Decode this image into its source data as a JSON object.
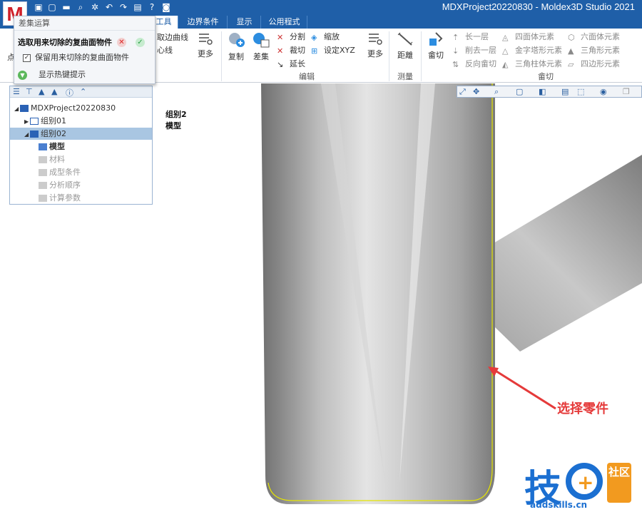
{
  "app": {
    "title": "MDXProject20220830 - Moldex3D Studio 2021",
    "logo": "M"
  },
  "quick_access": [
    "save-icon",
    "new-icon",
    "open-icon",
    "find-icon",
    "gear-icon",
    "undo-icon",
    "redo-icon",
    "report-icon",
    "help-icon",
    "camera-icon"
  ],
  "tabs": [
    {
      "label": "工具",
      "active": true
    },
    {
      "label": "边界条件"
    },
    {
      "label": "显示"
    },
    {
      "label": "公用程式"
    }
  ],
  "ribbon": {
    "left_items": [
      "取边曲线",
      "心线"
    ],
    "more1": "更多",
    "copy": "复制",
    "diff": "差集",
    "edit": {
      "split": "分割",
      "cut": "裁切",
      "extend": "延长",
      "scale": "缩放",
      "setxyz": "设定XYZ",
      "more": "更多"
    },
    "measure": {
      "distance": "距離",
      "more": "更多"
    },
    "dice": {
      "label": "畲切",
      "up": "长一层",
      "down": "削去一层",
      "rev": "反向畲切"
    },
    "elements": {
      "tetra": "四面体元素",
      "pyramid": "金字塔形元素",
      "prism": "三角柱体元素",
      "hexa": "六面体元素",
      "tri": "三角形元素",
      "quad": "四边形元素"
    },
    "groups": {
      "edit": "编辑",
      "measure": "测量",
      "dice": "畲切"
    }
  },
  "popup": {
    "header": "差集运算",
    "prompt": "选取用来切除的复曲面物件",
    "keep_label": "保留用来切除的复曲面物件",
    "keep_checked": true,
    "hotkey_label": "显示热键提示",
    "left_clip": "点"
  },
  "tree": {
    "nodes": [
      {
        "label": "MDXProject20220830",
        "level": 0,
        "expand": "◢"
      },
      {
        "label": "组别01",
        "level": 1,
        "expand": "▶"
      },
      {
        "label": "组别02",
        "level": 1,
        "expand": "◢",
        "selected": true
      },
      {
        "label": "模型",
        "level": 2,
        "bold": true
      },
      {
        "label": "材料",
        "level": 2,
        "grey": true
      },
      {
        "label": "成型条件",
        "level": 2,
        "grey": true
      },
      {
        "label": "分析顺序",
        "level": 2,
        "grey": true
      },
      {
        "label": "计算参数",
        "level": 2,
        "grey": true
      }
    ]
  },
  "viewport": {
    "group_label": "组别2",
    "model_label": "模型",
    "annotation": "选择零件",
    "annotation_color": "#e53a3a"
  },
  "watermark": {
    "brand": "技",
    "brand2": "社区",
    "url": "addskills.cn"
  }
}
